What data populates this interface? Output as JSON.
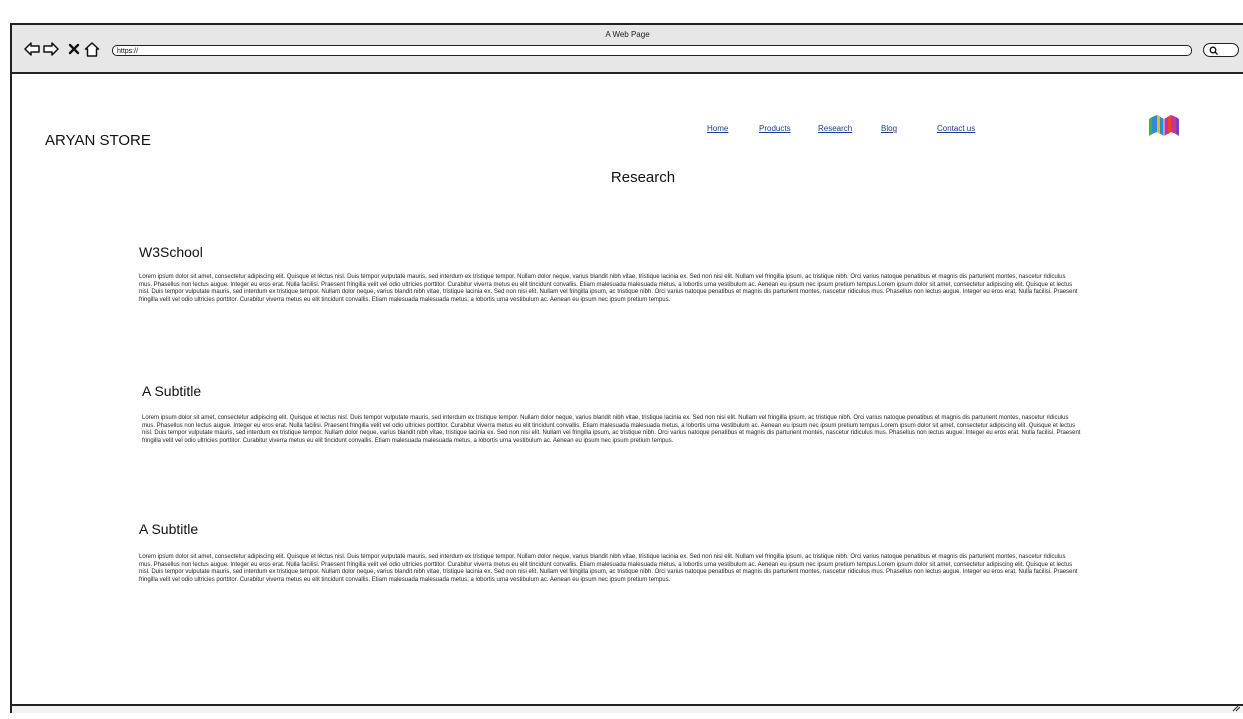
{
  "window": {
    "title": "A Web Page"
  },
  "browser": {
    "url": "https://",
    "icons": [
      "back-arrow-icon",
      "forward-arrow-icon",
      "close-x-icon",
      "home-icon",
      "search-icon"
    ]
  },
  "site": {
    "brand": "ARYAN STORE",
    "nav": [
      "Home",
      "Products",
      "Research",
      "Blog",
      "Contact us"
    ],
    "nav_color": "#1f3c8a",
    "logo_icon": "book-logo-icon"
  },
  "page": {
    "title": "Research",
    "sections": [
      {
        "heading": "W3School",
        "body": "Lorem ipsum dolor sit amet, consectetur adipiscing elit. Quisque et lectus nisl. Duis tempor vulputate mauris, sed interdum ex tristique tempor. Nullam dolor neque, varius blandit nibh vitae, tristique lacinia ex. Sed non nisi elit. Nullam vel fringilla ipsum, ac tristique nibh. Orci varius natoque penatibus et magnis dis parturient montes, nascetur ridiculus mus. Phasellus non lectus augue. Integer eu eros erat. Nulla facilisi. Praesent fringilla velit vel odio ultricies porttitor. Curabitur viverra metus eu elit tincidunt convallis. Etiam malesuada malesuada metus, a lobortis urna vestibulum ac. Aenean eu ipsum nec ipsum pretium tempus.Lorem ipsum dolor sit amet, consectetur adipiscing elit. Quisque et lectus nisl. Duis tempor vulputate mauris, sed interdum ex tristique tempor. Nullam dolor neque, varius blandit nibh vitae, tristique lacinia ex. Sed non nisi elit. Nullam vel fringilla ipsum, ac tristique nibh. Orci varius natoque penatibus et magnis dis parturient montes, nascetur ridiculus mus. Phasellus non lectus augue. Integer eu eros erat. Nulla facilisi. Praesent fringilla velit vel odio ultricies porttitor. Curabitur viverra metus eu elit tincidunt convallis. Etiam malesuada malesuada metus, a lobortis urna vestibulum ac. Aenean eu ipsum nec ipsum pretium tempus."
      },
      {
        "heading": "A Subtitle",
        "body": "Lorem ipsum dolor sit amet, consectetur adipiscing elit. Quisque et lectus nisl. Duis tempor vulputate mauris, sed interdum ex tristique tempor. Nullam dolor neque, varius blandit nibh vitae, tristique lacinia ex. Sed non nisi elit. Nullam vel fringilla ipsum, ac tristique nibh. Orci varius natoque penatibus et magnis dis parturient montes, nascetur ridiculus mus. Phasellus non lectus augue. Integer eu eros erat. Nulla facilisi. Praesent fringilla velit vel odio ultricies porttitor. Curabitur viverra metus eu elit tincidunt convallis. Etiam malesuada malesuada metus, a lobortis urna vestibulum ac. Aenean eu ipsum nec ipsum pretium tempus.Lorem ipsum dolor sit amet, consectetur adipiscing elit. Quisque et lectus nisl. Duis tempor vulputate mauris, sed interdum ex tristique tempor. Nullam dolor neque, varius blandit nibh vitae, tristique lacinia ex. Sed non nisi elit. Nullam vel fringilla ipsum, ac tristique nibh. Orci varius natoque penatibus et magnis dis parturient montes, nascetur ridiculus mus. Phasellus non lectus augue. Integer eu eros erat. Nulla facilisi. Praesent fringilla velit vel odio ultricies porttitor. Curabitur viverra metus eu elit tincidunt convallis. Etiam malesuada malesuada metus, a lobortis urna vestibulum ac. Aenean eu ipsum nec ipsum pretium tempus."
      },
      {
        "heading": "A Subtitle",
        "body": "Lorem ipsum dolor sit amet, consectetur adipiscing elit. Quisque et lectus nisl. Duis tempor vulputate mauris, sed interdum ex tristique tempor. Nullam dolor neque, varius blandit nibh vitae, tristique lacinia ex. Sed non nisi elit. Nullam vel fringilla ipsum, ac tristique nibh. Orci varius natoque penatibus et magnis dis parturient montes, nascetur ridiculus mus. Phasellus non lectus augue. Integer eu eros erat. Nulla facilisi. Praesent fringilla velit vel odio ultricies porttitor. Curabitur viverra metus eu elit tincidunt convallis. Etiam malesuada malesuada metus, a lobortis urna vestibulum ac. Aenean eu ipsum nec ipsum pretium tempus.Lorem ipsum dolor sit amet, consectetur adipiscing elit. Quisque et lectus nisl. Duis tempor vulputate mauris, sed interdum ex tristique tempor. Nullam dolor neque, varius blandit nibh vitae, tristique lacinia ex. Sed non nisi elit. Nullam vel fringilla ipsum, ac tristique nibh. Orci varius natoque penatibus et magnis dis parturient montes, nascetur ridiculus mus. Phasellus non lectus augue. Integer eu eros erat. Nulla facilisi. Praesent fringilla velit vel odio ultricies porttitor. Curabitur viverra metus eu elit tincidunt convallis. Etiam malesuada malesuada metus, a lobortis urna vestibulum ac. Aenean eu ipsum nec ipsum pretium tempus."
      }
    ]
  }
}
